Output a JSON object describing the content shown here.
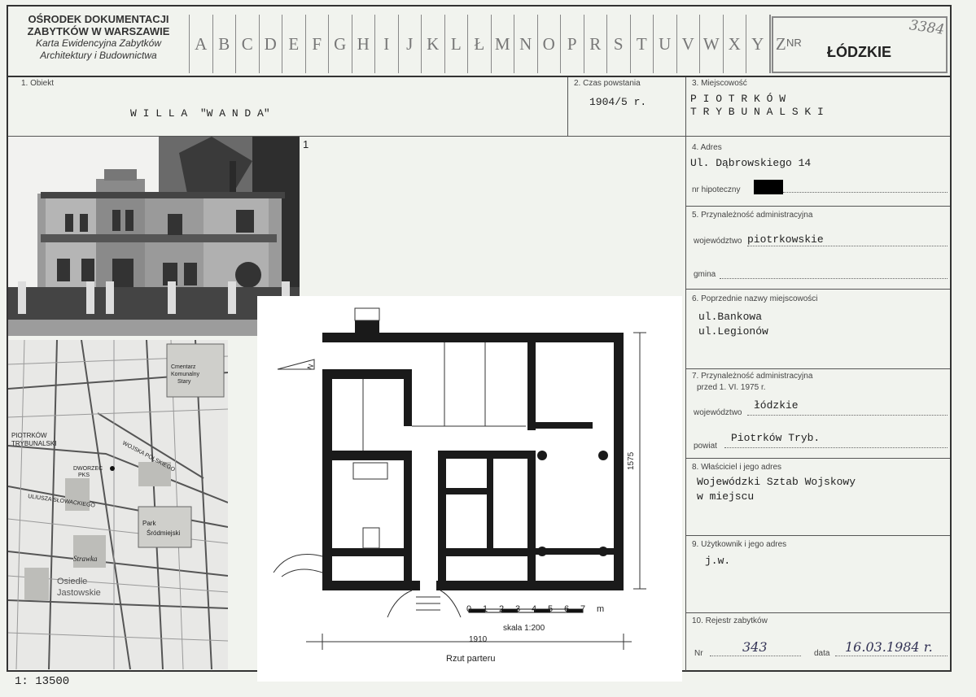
{
  "header": {
    "org_line1": "OŚRODEK DOKUMENTACJI",
    "org_line2": "ZABYTKÓW W WARSZAWIE",
    "org_line3": "Karta Ewidencyjna Zabytków",
    "org_line4": "Architektury i Budownictwa",
    "letters": [
      "A",
      "B",
      "C",
      "D",
      "E",
      "F",
      "G",
      "H",
      "I",
      "J",
      "K",
      "L",
      "Ł",
      "M",
      "N",
      "O",
      "P",
      "R",
      "S",
      "T",
      "U",
      "V",
      "W",
      "X",
      "Y",
      "Z"
    ],
    "nr_label": "NR",
    "region": "ŁÓDZKIE",
    "card_number": "3384"
  },
  "fields": {
    "obiekt_label": "1. Obiekt",
    "obiekt_value": "W I L L A  \"W A N D A\"",
    "czas_label": "2. Czas powstania",
    "czas_value": "1904/5 r.",
    "miejscowosc_label": "3. Miejscowość",
    "miejscowosc_line1": "P I O T R K Ó W",
    "miejscowosc_line2": "T R Y B U N A L S K I",
    "adres_label": "4. Adres",
    "adres_value": "Ul. Dąbrowskiego 14",
    "hipoteczny_label": "nr hipoteczny",
    "przynaleznosc_label": "5. Przynależność administracyjna",
    "wojewodztwo_label": "województwo",
    "wojewodztwo_value": "piotrkowskie",
    "gmina_label": "gmina",
    "poprzednie_label": "6. Poprzednie nazwy miejscowości",
    "poprzednie_line1": "ul.Bankowa",
    "poprzednie_line2": "ul.Legionów",
    "przed_label": "7. Przynależność administracyjna",
    "przed_sub": "przed 1. VI. 1975 r.",
    "woj2_label": "województwo",
    "woj2_value": "łódzkie",
    "powiat_label": "powiat",
    "powiat_value": "Piotrków Tryb.",
    "wlasciciel_label": "8. Właściciel i jego adres",
    "wlasciciel_line1": "Wojewódzki Sztab Wojskowy",
    "wlasciciel_line2": "w miejscu",
    "uzytkownik_label": "9. Użytkownik i jego adres",
    "uzytkownik_value": "j.w.",
    "rejestr_label": "10. Rejestr zabytków",
    "nr_label": "Nr",
    "rejestr_nr": "343",
    "data_label": "data",
    "rejestr_data": "16.03.1984 r."
  },
  "photo": {
    "index": "1"
  },
  "map": {
    "scale": "1: 13500",
    "labels": [
      "PIOTRKÓW TRYBUNALSKI",
      "DWORZEC PKS",
      "WOJSKA POLSKIEGO",
      "ULIUSZA SŁOWACKIEGO",
      "Park Śródmiejski",
      "Cmentarz Komunalny Stary",
      "Strawka",
      "Osiedle Jastowskie"
    ]
  },
  "plan": {
    "scale_numbers": [
      "0",
      "1",
      "2",
      "3",
      "4",
      "5",
      "6",
      "7",
      "m"
    ],
    "scale_text": "skala 1:200",
    "width_dim": "1910",
    "height_dim": "1575",
    "caption": "Rzut parteru",
    "north": "N"
  }
}
